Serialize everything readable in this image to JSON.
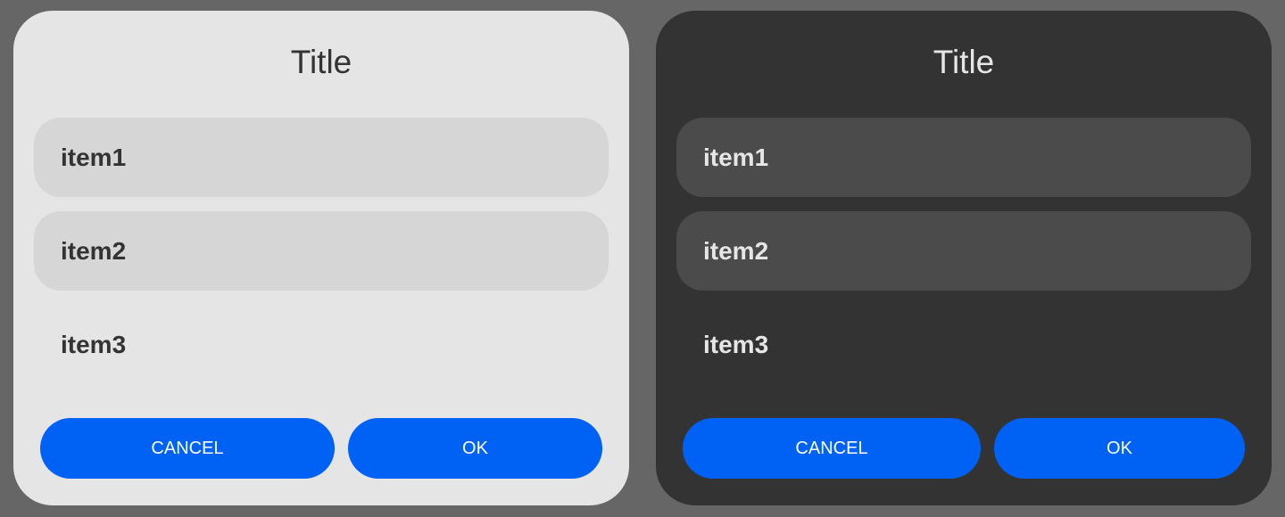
{
  "colors": {
    "backdrop": "#666666",
    "light_surface": "#e5e5e5",
    "light_selected": "#d6d6d6",
    "dark_surface": "#333333",
    "dark_selected": "#4b4b4b",
    "accent": "#0062f5"
  },
  "dialogs": [
    {
      "theme": "light",
      "title": "Title",
      "items": [
        {
          "label": "item1",
          "selected": true
        },
        {
          "label": "item2",
          "selected": true
        },
        {
          "label": "item3",
          "selected": false
        }
      ],
      "buttons": {
        "cancel": "CANCEL",
        "ok": "OK"
      }
    },
    {
      "theme": "dark",
      "title": "Title",
      "items": [
        {
          "label": "item1",
          "selected": true
        },
        {
          "label": "item2",
          "selected": true
        },
        {
          "label": "item3",
          "selected": false
        }
      ],
      "buttons": {
        "cancel": "CANCEL",
        "ok": "OK"
      }
    }
  ]
}
